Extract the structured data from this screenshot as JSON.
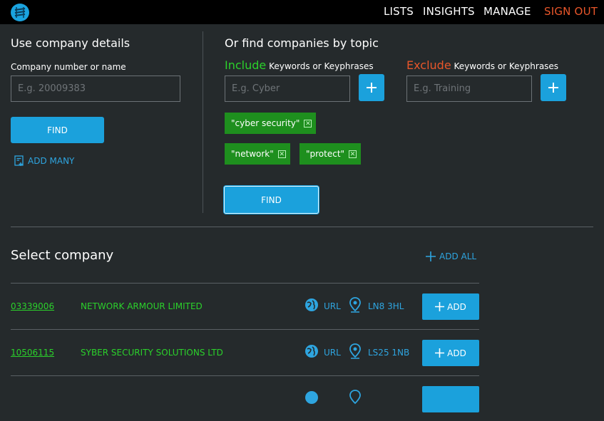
{
  "nav": {
    "lists": "LISTS",
    "insights": "INSIGHTS",
    "manage": "MANAGE",
    "signout": "SIGN OUT"
  },
  "left": {
    "title": "Use company details",
    "field_label": "Company number or name",
    "field_placeholder": "E.g. 20009383",
    "find_label": "FIND",
    "add_many_label": "ADD MANY"
  },
  "right": {
    "title": "Or find companies by topic",
    "include_word": "Include",
    "include_rest": " Keywords or Keyphrases",
    "include_placeholder": "E.g. Cyber",
    "exclude_word": "Exclude",
    "exclude_rest": " Keywords or Keyphrases",
    "exclude_placeholder": "E.g. Training",
    "chips": [
      "\"cyber security\"",
      "\"network\"",
      "\"protect\""
    ],
    "chip_close": "✕",
    "find_label": "FIND"
  },
  "results": {
    "title": "Select company",
    "add_all_label": "ADD ALL",
    "rows": [
      {
        "number": "03339006",
        "name": "NETWORK ARMOUR LIMITED",
        "url": "URL",
        "postcode": "LN8 3HL",
        "add": "ADD"
      },
      {
        "number": "10506115",
        "name": "SYBER SECURITY SOLUTIONS LTD",
        "url": "URL",
        "postcode": "LS25 1NB",
        "add": "ADD"
      }
    ]
  },
  "colors": {
    "accent": "#1ba1dc",
    "include": "#2bd12b",
    "exclude": "#e8562a",
    "chip": "#1e8f1e"
  },
  "icons": [
    "logo-icon",
    "plus-icon",
    "add-many-icon",
    "globe-icon",
    "map-pin-icon",
    "close-icon"
  ]
}
